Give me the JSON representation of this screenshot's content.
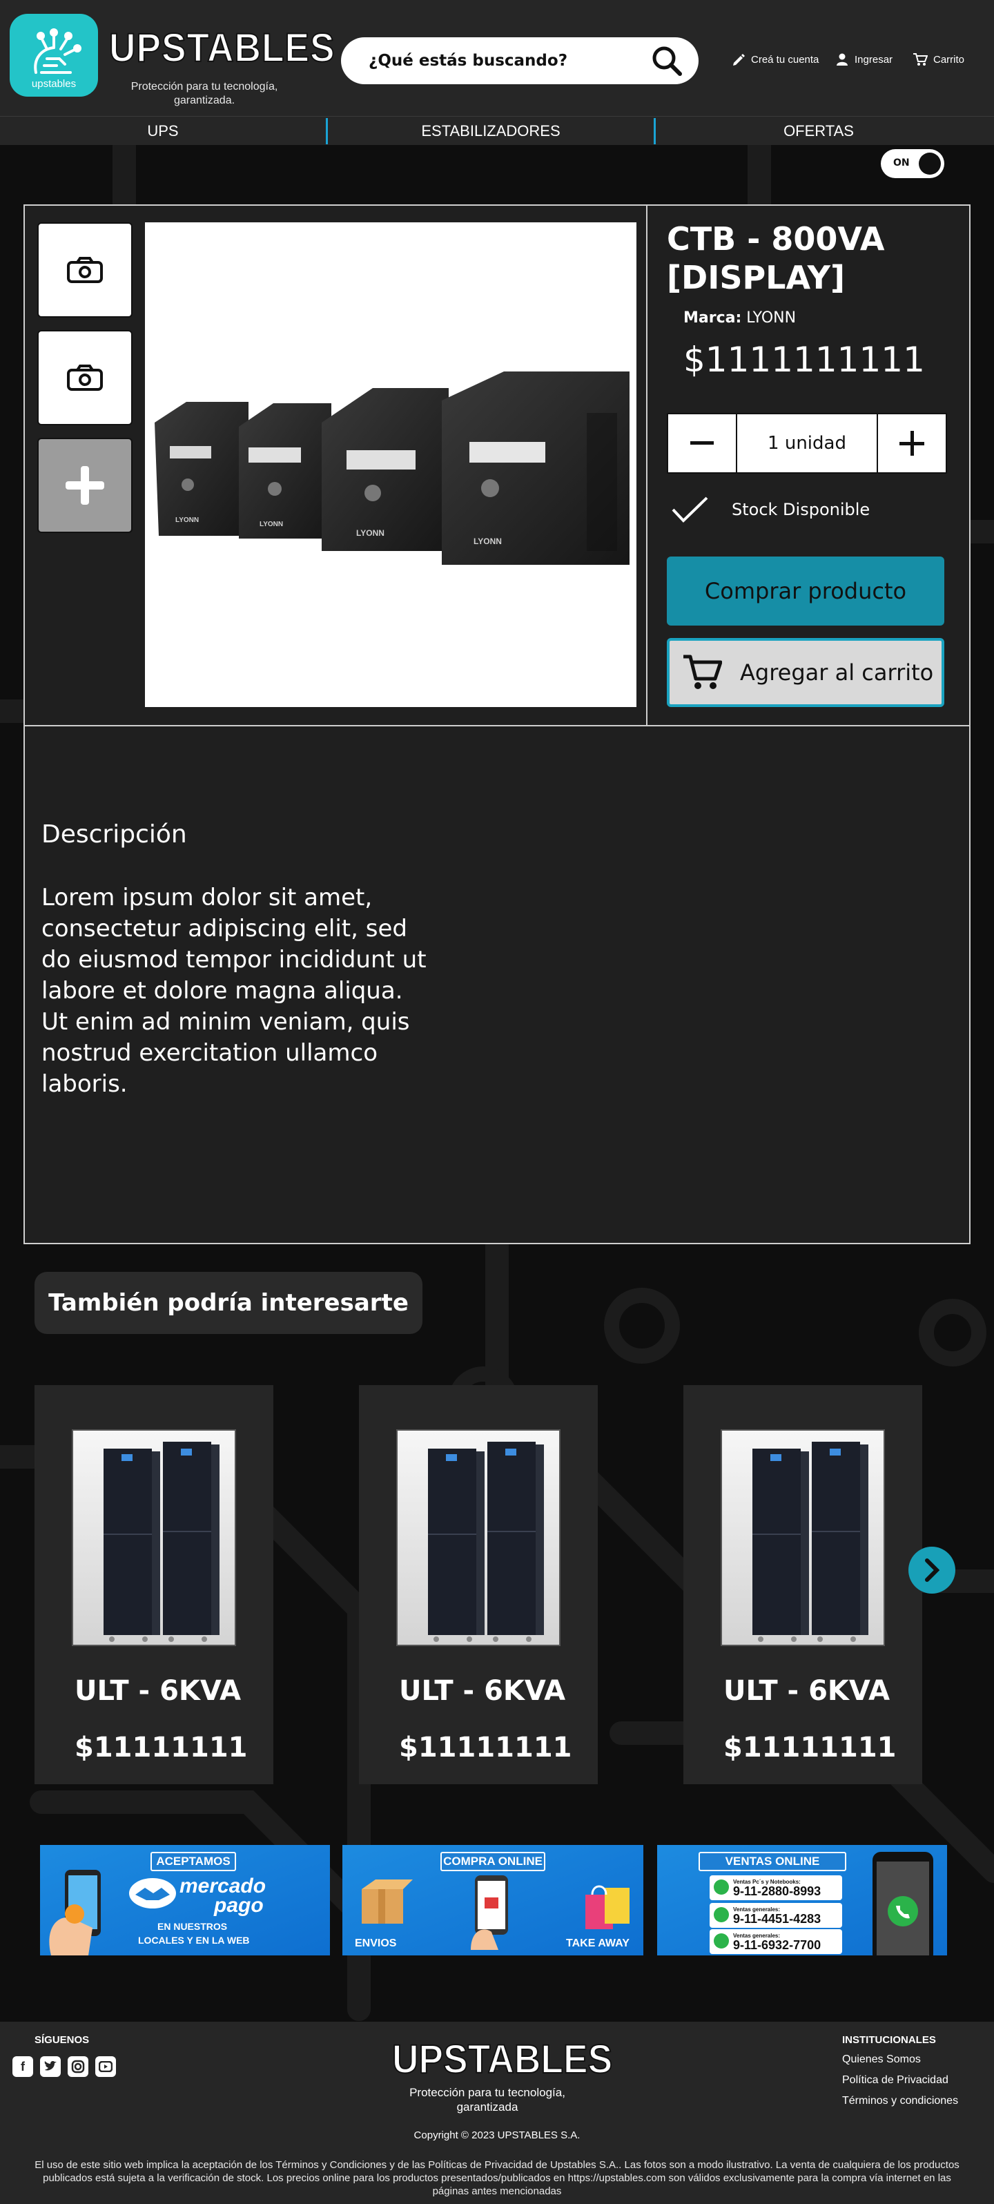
{
  "header": {
    "logo_badge_text": "upstables",
    "brand_name": "UPSTABLES",
    "tagline": "Protección para tu tecnología, garantizada.",
    "search_placeholder": "¿Qué estás buscando?",
    "create_account": "Creá tu cuenta",
    "login": "Ingresar",
    "cart": "Carrito"
  },
  "nav": {
    "items": [
      {
        "label": "UPS"
      },
      {
        "label": "ESTABILIZADORES"
      },
      {
        "label": "OFERTAS"
      }
    ]
  },
  "toggle": {
    "label": "ON"
  },
  "product": {
    "title": "CTB - 800VA [DISPLAY]",
    "brand_label": "Marca:",
    "brand_value": "LYONN",
    "price": "$1111111111",
    "quantity": "1 unidad",
    "stock": "Stock Disponible",
    "buy_label": "Comprar producto",
    "cart_label": "Agregar al carrito",
    "ups_brand_marks": [
      "LYONN",
      "LYONN",
      "LYONN",
      "LYONN"
    ],
    "description_title": "Descripción",
    "description_text": "Lorem ipsum dolor sit amet, consectetur adipiscing elit, sed do eiusmod tempor incididunt ut labore et dolore magna aliqua. Ut enim ad minim veniam, quis nostrud exercitation ullamco laboris."
  },
  "related": {
    "heading": "También podría interesarte",
    "cards": [
      {
        "title": "ULT - 6KVA",
        "price": "$11111111"
      },
      {
        "title": "ULT - 6KVA",
        "price": "$11111111"
      },
      {
        "title": "ULT - 6KVA",
        "price": "$11111111"
      }
    ]
  },
  "banners": {
    "mp": {
      "tag": "ACEPTAMOS",
      "brand1": "mercado",
      "brand2": "pago",
      "sub1": "EN NUESTROS",
      "sub2": "LOCALES Y EN LA WEB"
    },
    "online": {
      "tag": "COMPRA ONLINE",
      "left": "ENVIOS",
      "right": "TAKE AWAY"
    },
    "ventas": {
      "tag": "VENTAS ONLINE",
      "lines": [
        {
          "caption": "Ventas Pc´s y Notebooks:",
          "number": "9-11-2880-8993"
        },
        {
          "caption": "Ventas generales:",
          "number": "9-11-4451-4283"
        },
        {
          "caption": "Ventas generales:",
          "number": "9-11-6932-7700"
        }
      ]
    }
  },
  "footer": {
    "follow": "SÍGUENOS",
    "brand_name": "UPSTABLES",
    "tagline": "Protección para tu tecnología, garantizada",
    "institutional": "INSTITUCIONALES",
    "links": [
      "Quienes Somos",
      "Política de Privacidad",
      "Términos y condiciones"
    ],
    "copyright": "Copyright © 2023 UPSTABLES S.A.",
    "legal": "El uso de este sitio web implica la aceptación de los Términos y Condiciones y de las Políticas de Privacidad de Upstables S.A.. Las fotos son a modo ilustrativo. La venta de cualquiera de los productos publicados está sujeta a la verificación de stock. Los precios online para los productos presentados/publicados en https://upstables.com  son válidos exclusivamente para la compra vía internet en las páginas antes mencionadas"
  },
  "colors": {
    "accent": "#1aa3d4",
    "buy_button": "#168ea6",
    "logo_badge": "#23c4c8",
    "header_bg": "#262626",
    "page_bg": "#0e0e0e"
  }
}
